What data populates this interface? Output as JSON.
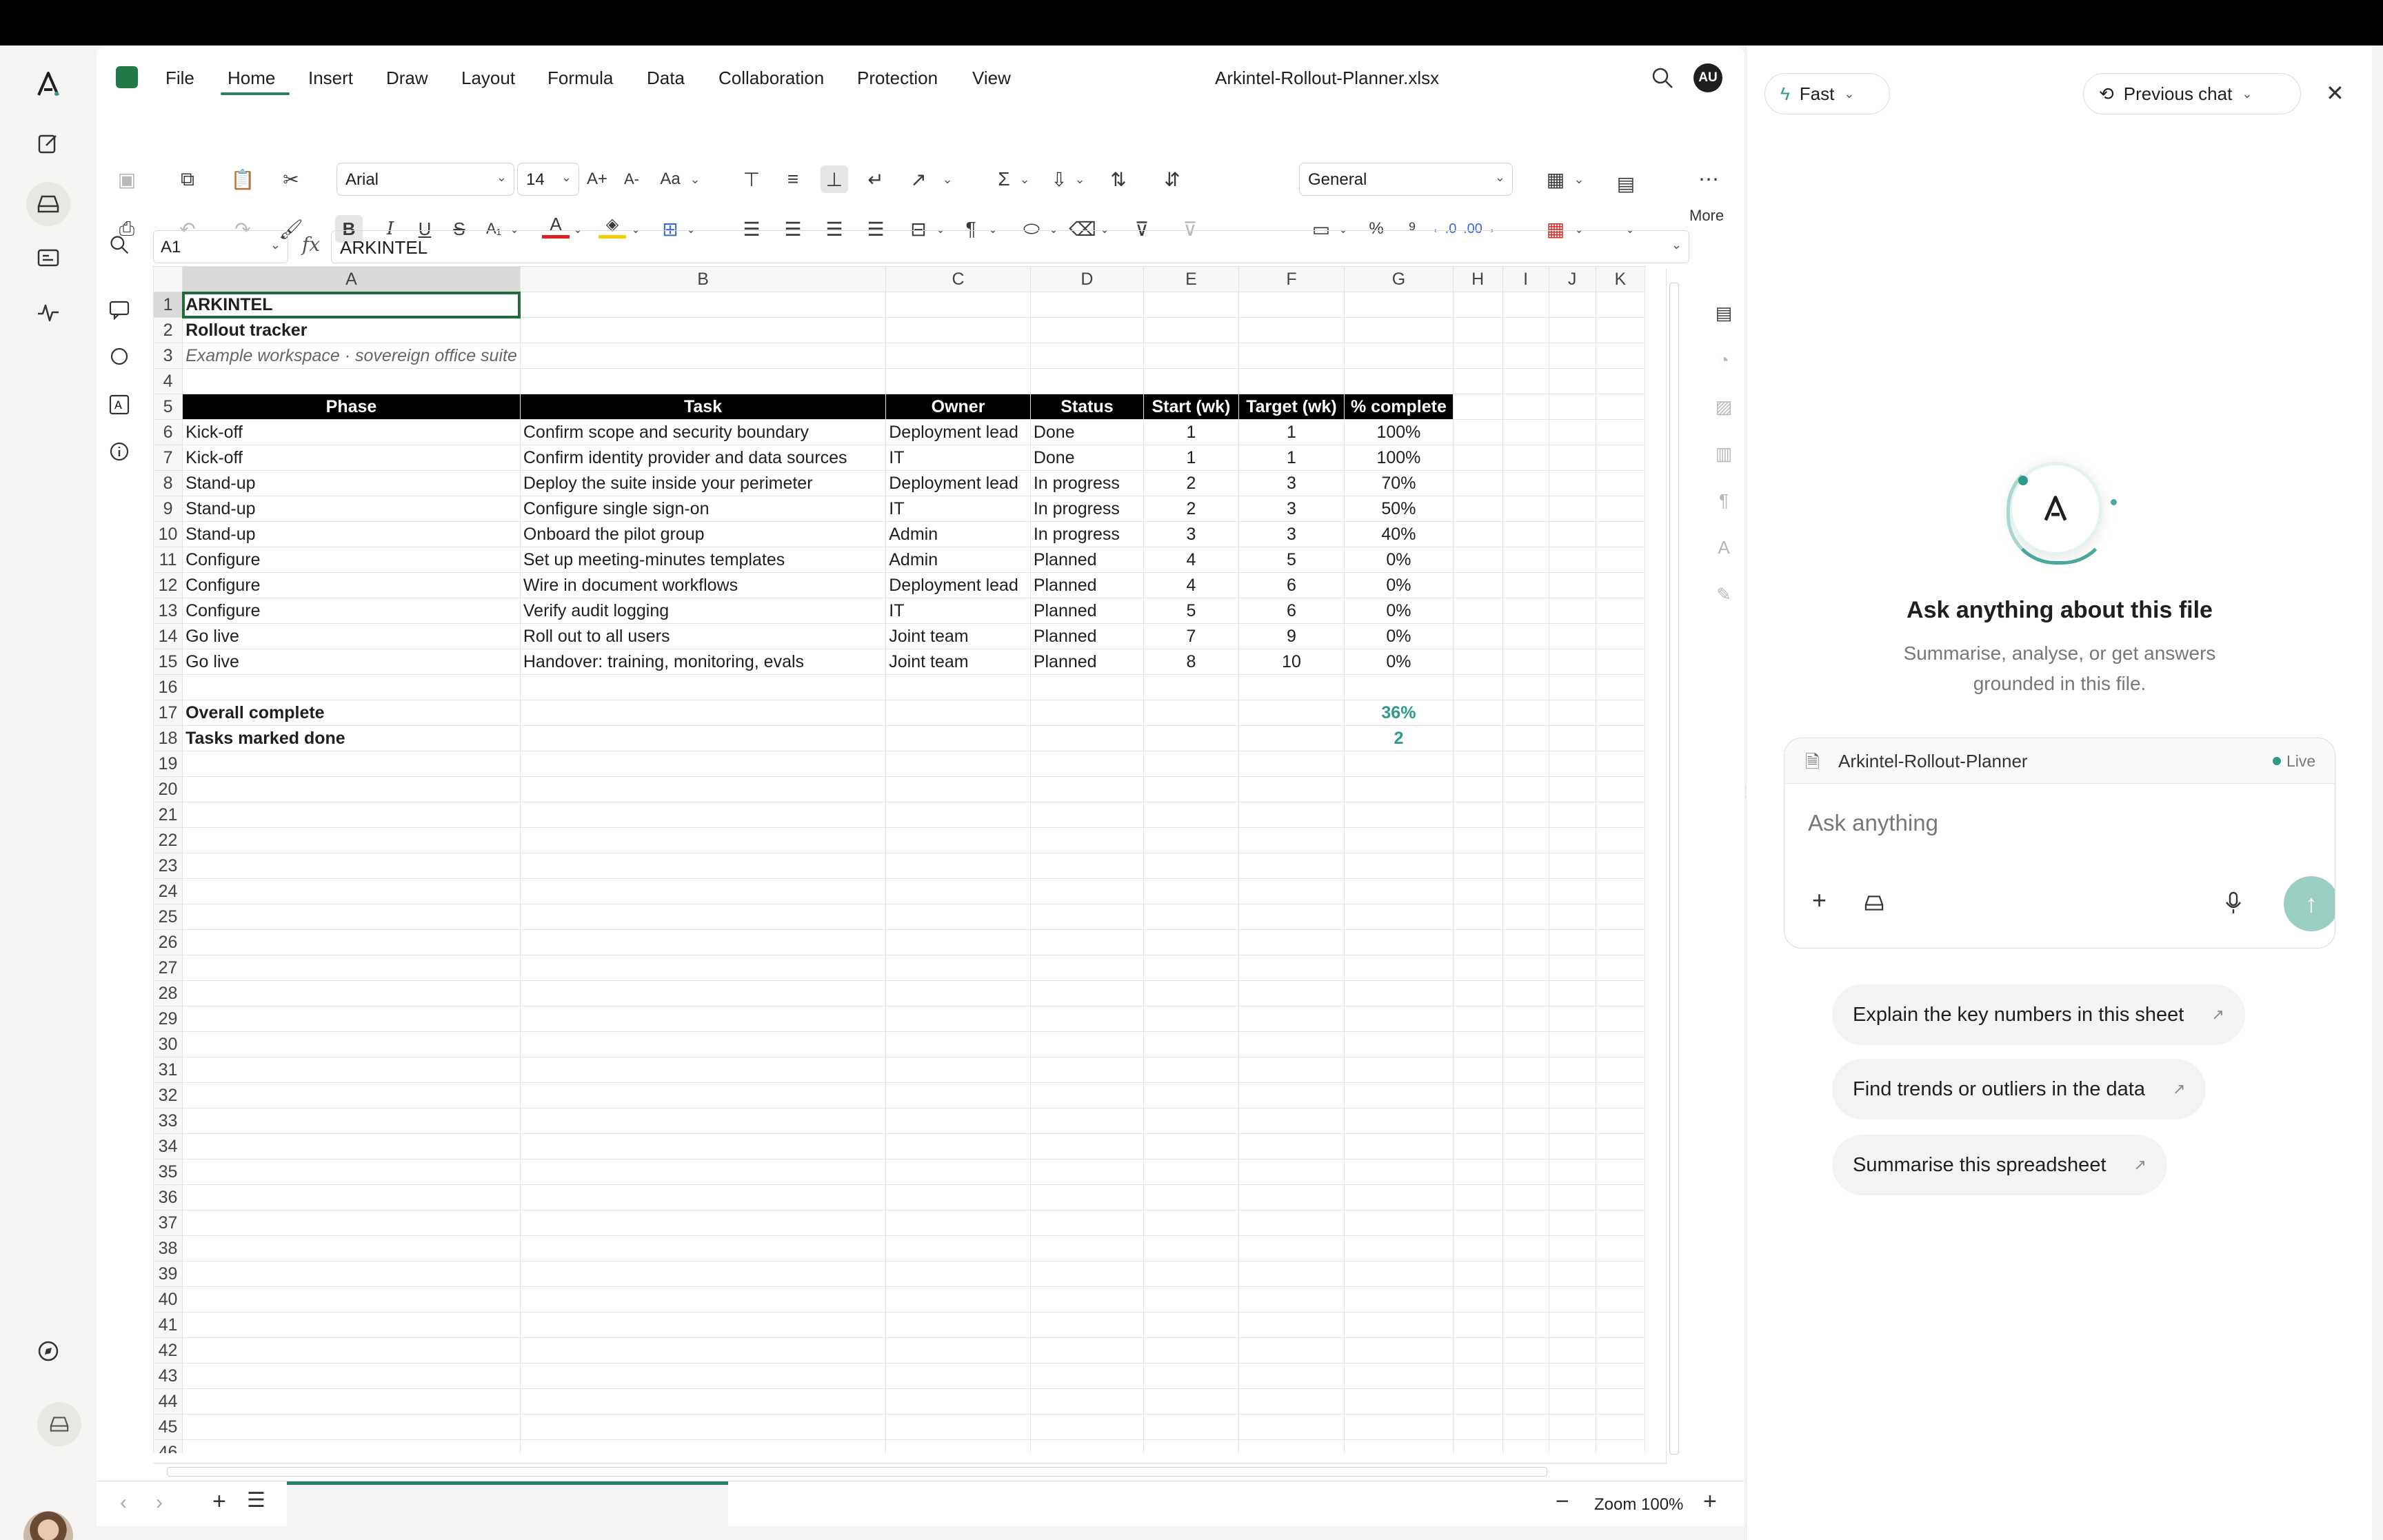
{
  "app": {
    "document_title": "Arkintel-Rollout-Planner.xlsx",
    "user_initials": "AU"
  },
  "menu": [
    "File",
    "Home",
    "Insert",
    "Draw",
    "Layout",
    "Formula",
    "Data",
    "Collaboration",
    "Protection",
    "View"
  ],
  "ribbon": {
    "font_name": "Arial",
    "font_size": "14",
    "number_format": "General",
    "more_label": "More"
  },
  "formula_bar": {
    "cell_ref": "A1",
    "fx": "fx",
    "value": "ARKINTEL"
  },
  "sheet": {
    "columns": [
      "A",
      "B",
      "C",
      "D",
      "E",
      "F",
      "G",
      "H",
      "I",
      "J",
      "K"
    ],
    "row_count": 46,
    "title": "ARKINTEL",
    "subtitle": "Rollout tracker",
    "caption": "Example workspace · sovereign office suite",
    "headers": [
      "Phase",
      "Task",
      "Owner",
      "Status",
      "Start (wk)",
      "Target (wk)",
      "% complete"
    ],
    "rows": [
      [
        "Kick-off",
        "Confirm scope and security boundary",
        "Deployment lead",
        "Done",
        "1",
        "1",
        "100%"
      ],
      [
        "Kick-off",
        "Confirm identity provider and data sources",
        "IT",
        "Done",
        "1",
        "1",
        "100%"
      ],
      [
        "Stand-up",
        "Deploy the suite inside your perimeter",
        "Deployment lead",
        "In progress",
        "2",
        "3",
        "70%"
      ],
      [
        "Stand-up",
        "Configure single sign-on",
        "IT",
        "In progress",
        "2",
        "3",
        "50%"
      ],
      [
        "Stand-up",
        "Onboard the pilot group",
        "Admin",
        "In progress",
        "3",
        "3",
        "40%"
      ],
      [
        "Configure",
        "Set up meeting-minutes templates",
        "Admin",
        "Planned",
        "4",
        "5",
        "0%"
      ],
      [
        "Configure",
        "Wire in document workflows",
        "Deployment lead",
        "Planned",
        "4",
        "6",
        "0%"
      ],
      [
        "Configure",
        "Verify audit logging",
        "IT",
        "Planned",
        "5",
        "6",
        "0%"
      ],
      [
        "Go live",
        "Roll out to all users",
        "Joint team",
        "Planned",
        "7",
        "9",
        "0%"
      ],
      [
        "Go live",
        "Handover: training, monitoring, evals",
        "Joint team",
        "Planned",
        "8",
        "10",
        "0%"
      ]
    ],
    "summary": [
      {
        "label": "Overall complete",
        "value": "36%"
      },
      {
        "label": "Tasks marked done",
        "value": "2"
      }
    ]
  },
  "status_bar": {
    "zoom_label": "Zoom 100%"
  },
  "assistant": {
    "mode_label": "Fast",
    "history_label": "Previous chat",
    "heading": "Ask anything about this file",
    "description": "Summarise, analyse, or get answers grounded in this file.",
    "file_name": "Arkintel-Rollout-Planner",
    "live_label": "Live",
    "input_placeholder": "Ask anything",
    "suggestions": [
      "Explain the key numbers in this sheet",
      "Find trends or outliers in the data",
      "Summarise this spreadsheet"
    ]
  },
  "colors": {
    "accent": "#2e7d6b",
    "teal_value": "#2e9b88",
    "header_fill": "#000000",
    "send_button": "#9bcfc4",
    "live_dot": "#2e9b88"
  }
}
